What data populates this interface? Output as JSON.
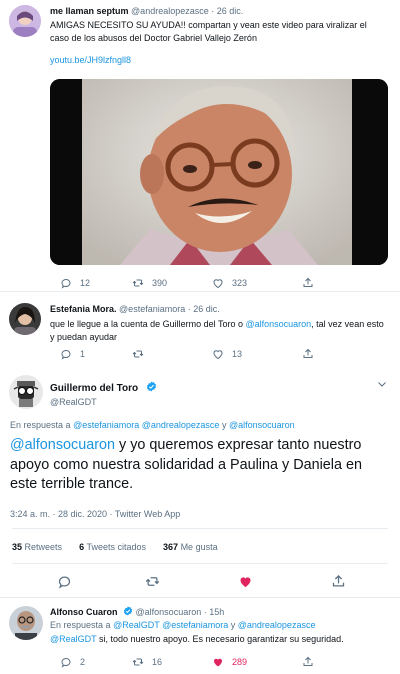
{
  "tweet1": {
    "name": "me llaman septum",
    "handle": "@andrealopezasce",
    "sep": "·",
    "date": "26 dic.",
    "text_a": "AMIGAS NECESITO SU AYUDA!! compartan y vean este video para viralizar el caso de los abusos del Doctor Gabriel Vallejo Zerón",
    "link": "youtu.be/JH9lzfngll8",
    "replies": "12",
    "retweets": "390",
    "likes": "323"
  },
  "tweet2": {
    "name": "Estefania Mora.",
    "handle": "@estefaniamora",
    "sep": "·",
    "date": "26 dic.",
    "text_a": "que le llegue a la cuenta de Guillermo del Toro o",
    "mention": "@alfonsocuaron",
    "text_b": ", tal vez vean esto y puedan ayudar",
    "replies": "1",
    "likes": "13"
  },
  "main": {
    "name": "Guillermo del Toro",
    "handle": "@RealGDT",
    "reply_prefix": "En respuesta a",
    "reply_m1": "@estefaniamora",
    "reply_m2": "@andrealopezasce",
    "reply_and": "y",
    "reply_m3": "@alfonsocuaron",
    "mention": "@alfonsocuaron",
    "text": " y yo queremos expresar tanto nuestro apoyo como nuestra solidaridad a Paulina y Daniela en este terrible trance.",
    "time": "3:24 a. m. · 28 dic. 2020 · Twitter Web App",
    "retweets_count": "35",
    "retweets_label": "Retweets",
    "quotes_count": "6",
    "quotes_label": "Tweets citados",
    "likes_count": "367",
    "likes_label": "Me gusta"
  },
  "tweet4": {
    "name": "Alfonso Cuaron",
    "handle": "@alfonsocuaron",
    "sep": "·",
    "date": "15h",
    "reply_prefix": "En respuesta a",
    "reply_m1": "@RealGDT",
    "reply_m2": "@estefaniamora",
    "reply_and": "y",
    "reply_m3": "@andrealopezasce",
    "mention": "@RealGDT",
    "text": " si, todo nuestro apoyo. Es necesario garantizar su seguridad.",
    "replies": "2",
    "retweets": "16",
    "likes": "289"
  },
  "colors": {
    "accent": "#1b95e0",
    "like": "#e0245e",
    "muted": "#5b7083",
    "verified": "#1da1f2"
  }
}
